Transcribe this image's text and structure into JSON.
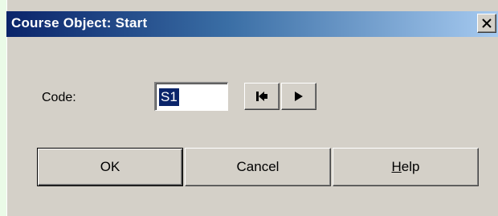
{
  "window": {
    "title": "Course Object: Start",
    "close_icon": "close-icon"
  },
  "form": {
    "code_label": "Code:",
    "code_value": "S1",
    "first_icon": "skip-to-first-icon",
    "next_icon": "play-next-icon"
  },
  "buttons": {
    "ok_label": "OK",
    "cancel_label": "Cancel",
    "help_mnemonic": "H",
    "help_rest": "elp"
  },
  "colors": {
    "titlebar_start": "#0a246a",
    "titlebar_end": "#a6caf0",
    "dialog_face": "#d4d0c8",
    "page_background": "#eafbe7"
  }
}
